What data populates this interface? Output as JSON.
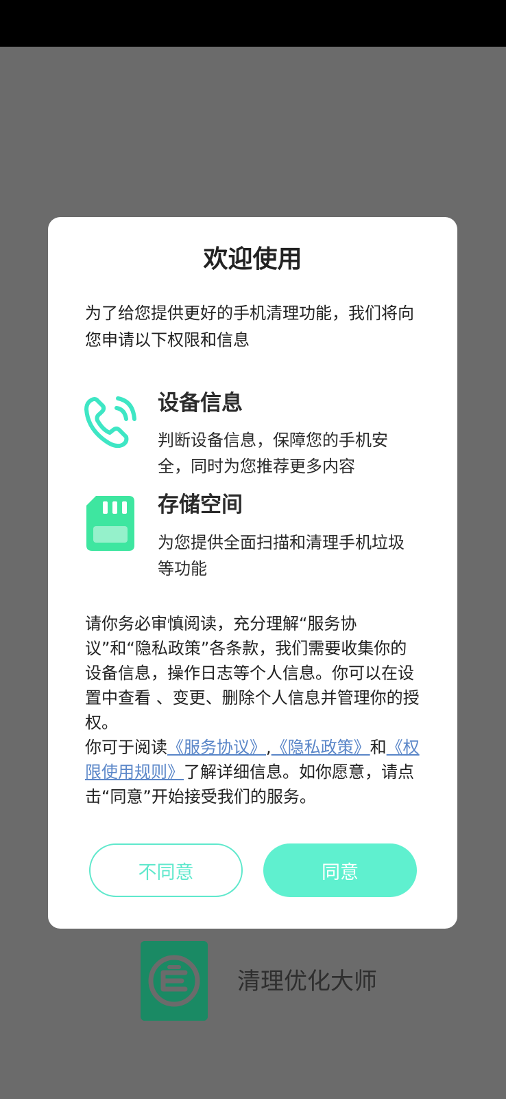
{
  "dialog": {
    "title": "欢迎使用",
    "intro": "为了给您提供更好的手机清理功能，我们将向您申请以下权限和信息",
    "permissions": [
      {
        "icon": "phone-icon",
        "title": "设备信息",
        "desc": "判断设备信息，保障您的手机安全，同时为您推荐更多内容"
      },
      {
        "icon": "sd-card-icon",
        "title": "存储空间",
        "desc": "为您提供全面扫描和清理手机垃圾等功能"
      }
    ],
    "notice": {
      "para1": "请你务必审慎阅读，充分理解“服务协议”和“隐私政策”各条款，我们需要收集你的设备信息，操作日志等个人信息。你可以在设置中查看 、变更、删除个人信息并管理你的授权。",
      "read_prefix": "你可于阅读",
      "link_service": "《服务协议》",
      "comma": ",",
      "link_privacy": "《隐私政策》",
      "and": "和",
      "link_permission": "《权限使用规则》",
      "read_suffix": "了解详细信息。如你愿意，请点击“同意”开始接受我们的服务。"
    },
    "buttons": {
      "disagree": "不同意",
      "agree": "同意"
    }
  },
  "app": {
    "name": "清理优化大师",
    "logo_icon": "shield-logo-icon"
  },
  "colors": {
    "accent": "#5ff0cf",
    "accent_border": "#5fe8cc",
    "link": "#5a86c8",
    "overlay": "#6b6b6b",
    "logo": "#1a8a64"
  }
}
